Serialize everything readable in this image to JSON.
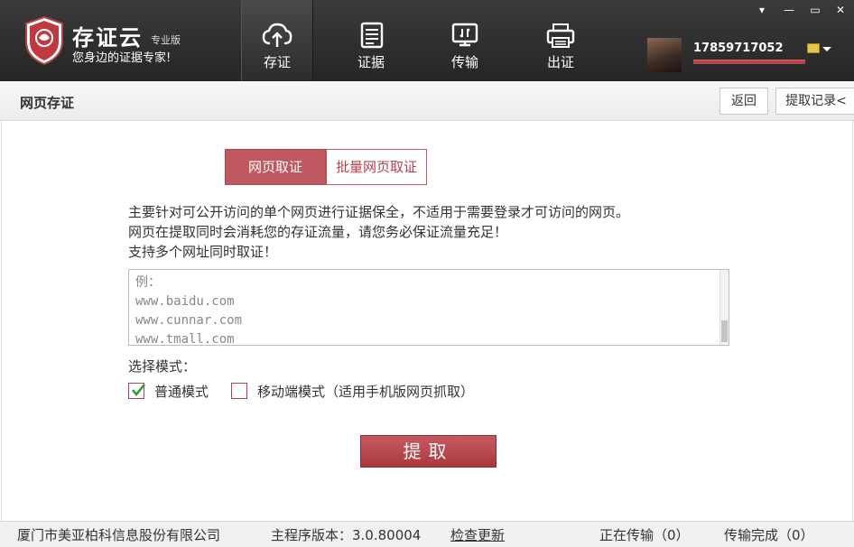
{
  "window": {
    "minimize": "—",
    "restore": "▭",
    "close": "✕",
    "menu": "▾"
  },
  "brand": {
    "title": "存证云",
    "edition": "专业版",
    "slogan": "您身边的证据专家!",
    "logo_text": "存证云"
  },
  "nav": [
    {
      "label": "存证",
      "icon": "cloud-upload-icon",
      "active": true
    },
    {
      "label": "证据",
      "icon": "document-icon",
      "active": false
    },
    {
      "label": "传输",
      "icon": "monitor-transfer-icon",
      "active": false
    },
    {
      "label": "出证",
      "icon": "printer-icon",
      "active": false
    }
  ],
  "user": {
    "phone": "17859717052",
    "badge_icon": "id-card-icon"
  },
  "subheader": {
    "title": "网页存证",
    "back_label": "返回",
    "records_label": "提取记录<"
  },
  "tabs": {
    "single": "网页取证",
    "batch": "批量网页取证"
  },
  "description": [
    "主要针对可公开访问的单个网页进行证据保全，不适用于需要登录才可访问的网页。",
    "网页在提取同时会消耗您的存证流量，请您务必保证流量充足！",
    "支持多个网址同时取证！"
  ],
  "url_box": {
    "placeholder": "例：\nwww.baidu.com\nwww.cunnar.com\nwww.tmall.com"
  },
  "mode": {
    "label": "选择模式：",
    "options": [
      {
        "label": "普通模式",
        "checked": true
      },
      {
        "label": "移动端模式（适用手机版网页抓取）",
        "checked": false
      }
    ]
  },
  "submit_label": "提取",
  "footer": {
    "company": "厦门市美亚柏科信息股份有限公司",
    "version_label": "主程序版本：3.0.80004",
    "update_link": "检查更新",
    "transferring": "正在传输（0）",
    "completed": "传输完成（0）"
  },
  "colors": {
    "accent": "#c0595f",
    "header_bg": "#2e2e2e",
    "user_bar": "#b8424c"
  }
}
